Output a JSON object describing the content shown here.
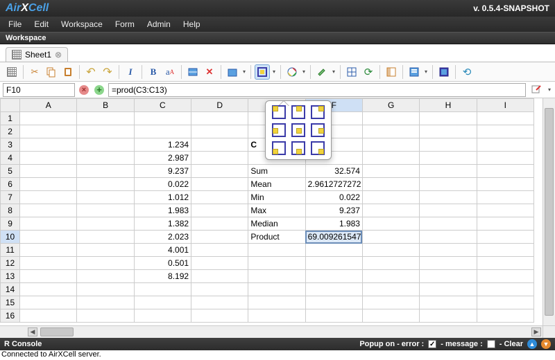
{
  "app": {
    "logo_air": "Air",
    "logo_x": "X",
    "logo_cell": "Cell",
    "version": "v. 0.5.4-SNAPSHOT"
  },
  "menu": [
    "File",
    "Edit",
    "Workspace",
    "Form",
    "Admin",
    "Help"
  ],
  "workspace_label": "Workspace",
  "tab": {
    "name": "Sheet1"
  },
  "formula": {
    "cell_ref": "F10",
    "content": "=prod(C3:C13)"
  },
  "columns": [
    "A",
    "B",
    "C",
    "D",
    "E",
    "F",
    "G",
    "H",
    "I"
  ],
  "row_count": 16,
  "cells": {
    "C3": "1.234",
    "C4": "2.987",
    "C5": "9.237",
    "C6": "0.022",
    "C7": "1.012",
    "C8": "1.983",
    "C9": "1.382",
    "C10": "2.023",
    "C11": "4.001",
    "C12": "0.501",
    "C13": "8.192",
    "E3": "C",
    "E5": "Sum",
    "E6": "Mean",
    "E7": "Min",
    "E8": "Max",
    "E9": "Median",
    "E10": "Product",
    "F5": "32.574",
    "F6": "2.9612727272",
    "F7": "0.022",
    "F8": "9.237",
    "F9": "1.983",
    "F10": "69.009261547"
  },
  "selected_cell": "F10",
  "status": {
    "left": "R Console",
    "popup_label": "Popup on - error :",
    "error_checked": true,
    "message_label": "- message :",
    "message_checked": false,
    "clear_label": "-  Clear"
  },
  "footer": "Connected to AirXCell server."
}
